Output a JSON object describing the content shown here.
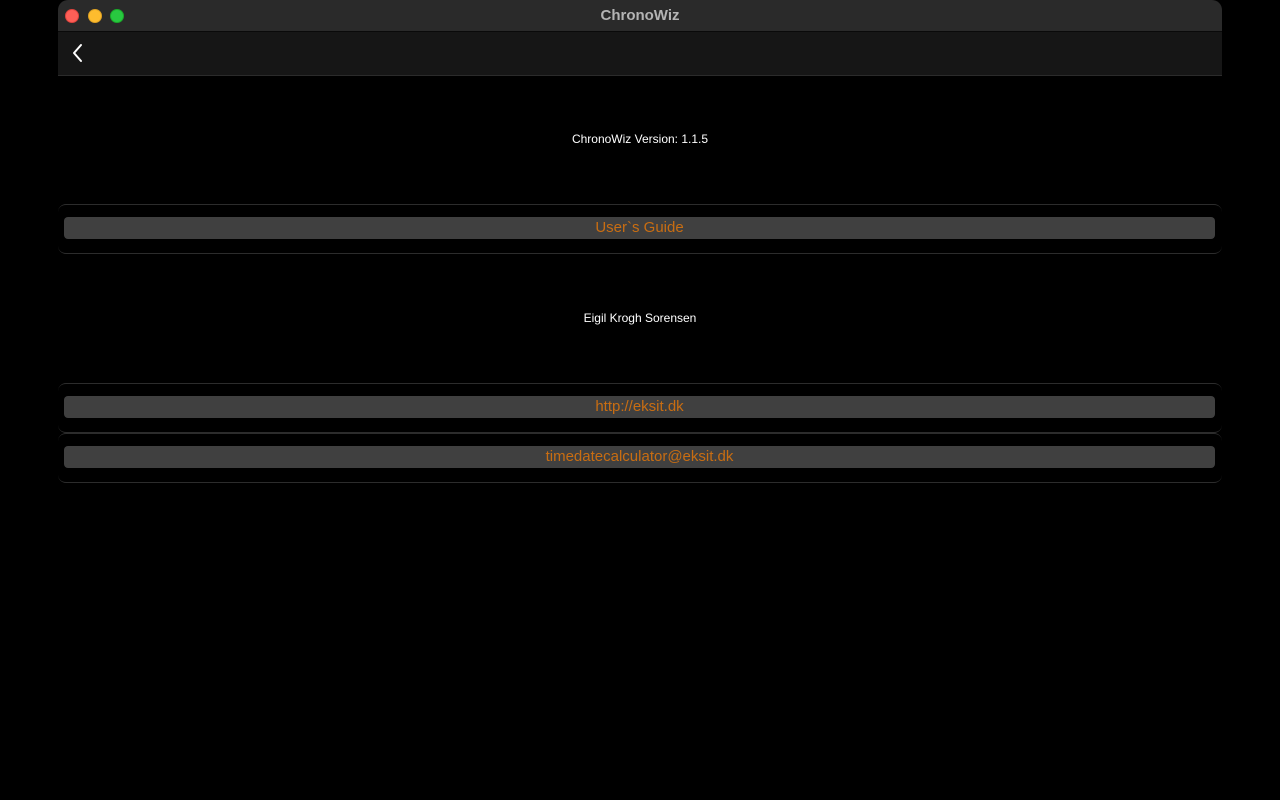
{
  "window": {
    "title": "ChronoWiz"
  },
  "navbar": {
    "back_icon": "chevron-left-icon"
  },
  "about": {
    "version_text": "ChronoWiz  Version: 1.1.5",
    "guide_label": "User`s Guide",
    "author": "Eigil Krogh Sorensen",
    "website_label": "http://eksit.dk",
    "email_label": "timedatecalculator@eksit.dk"
  },
  "colors": {
    "background": "#000000",
    "link_text": "#c86d12",
    "button_fill": "#404040"
  }
}
